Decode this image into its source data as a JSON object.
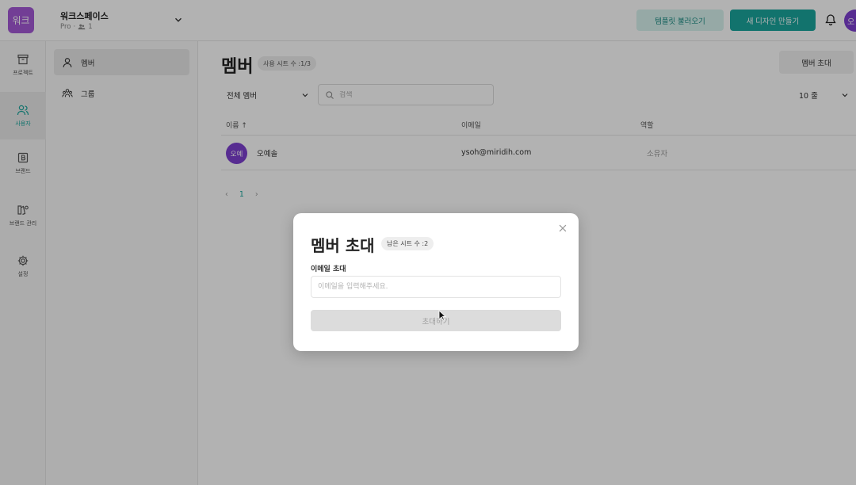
{
  "workspace": {
    "logo_text": "워크",
    "name": "워크스페이스",
    "plan": "Pro",
    "member_count": "1"
  },
  "header": {
    "template_button": "템플릿 불러오기",
    "new_design_button": "새 디자인 만들기",
    "avatar_initial": "오"
  },
  "rail": {
    "items": [
      {
        "label": "프로젝트",
        "icon": "archive-icon"
      },
      {
        "label": "사용자",
        "icon": "users-icon"
      },
      {
        "label": "브랜드",
        "icon": "brand-icon"
      },
      {
        "label": "브랜드 관리",
        "icon": "brand-manage-icon"
      },
      {
        "label": "설정",
        "icon": "gear-icon"
      }
    ]
  },
  "subnav": {
    "items": [
      {
        "label": "멤버",
        "icon": "user-icon"
      },
      {
        "label": "그룹",
        "icon": "group-icon"
      }
    ]
  },
  "main": {
    "title": "멤버",
    "seat_badge": "사용 시트 수 :1/3",
    "invite_button": "멤버 초대",
    "filter_value": "전체 멤버",
    "search_placeholder": "검색",
    "rows_per_page": "10 줄",
    "table": {
      "headers": [
        "이름 ↑",
        "이메일",
        "역할"
      ],
      "rows": [
        {
          "avatar": "오예",
          "name": "오예솔",
          "email": "ysoh@miridih.com",
          "role": "소유자"
        }
      ]
    },
    "pager": {
      "prev": "‹",
      "current": "1",
      "next": "›"
    }
  },
  "modal": {
    "title": "멤버 초대",
    "badge": "남은 시트 수 :2",
    "email_label": "이메일 초대",
    "email_placeholder": "이메일을 입력해주세요.",
    "submit_button": "초대하기"
  },
  "colors": {
    "accent": "#1aa59c",
    "logo": "#a45ad6",
    "avatar": "#7d3fd0"
  }
}
